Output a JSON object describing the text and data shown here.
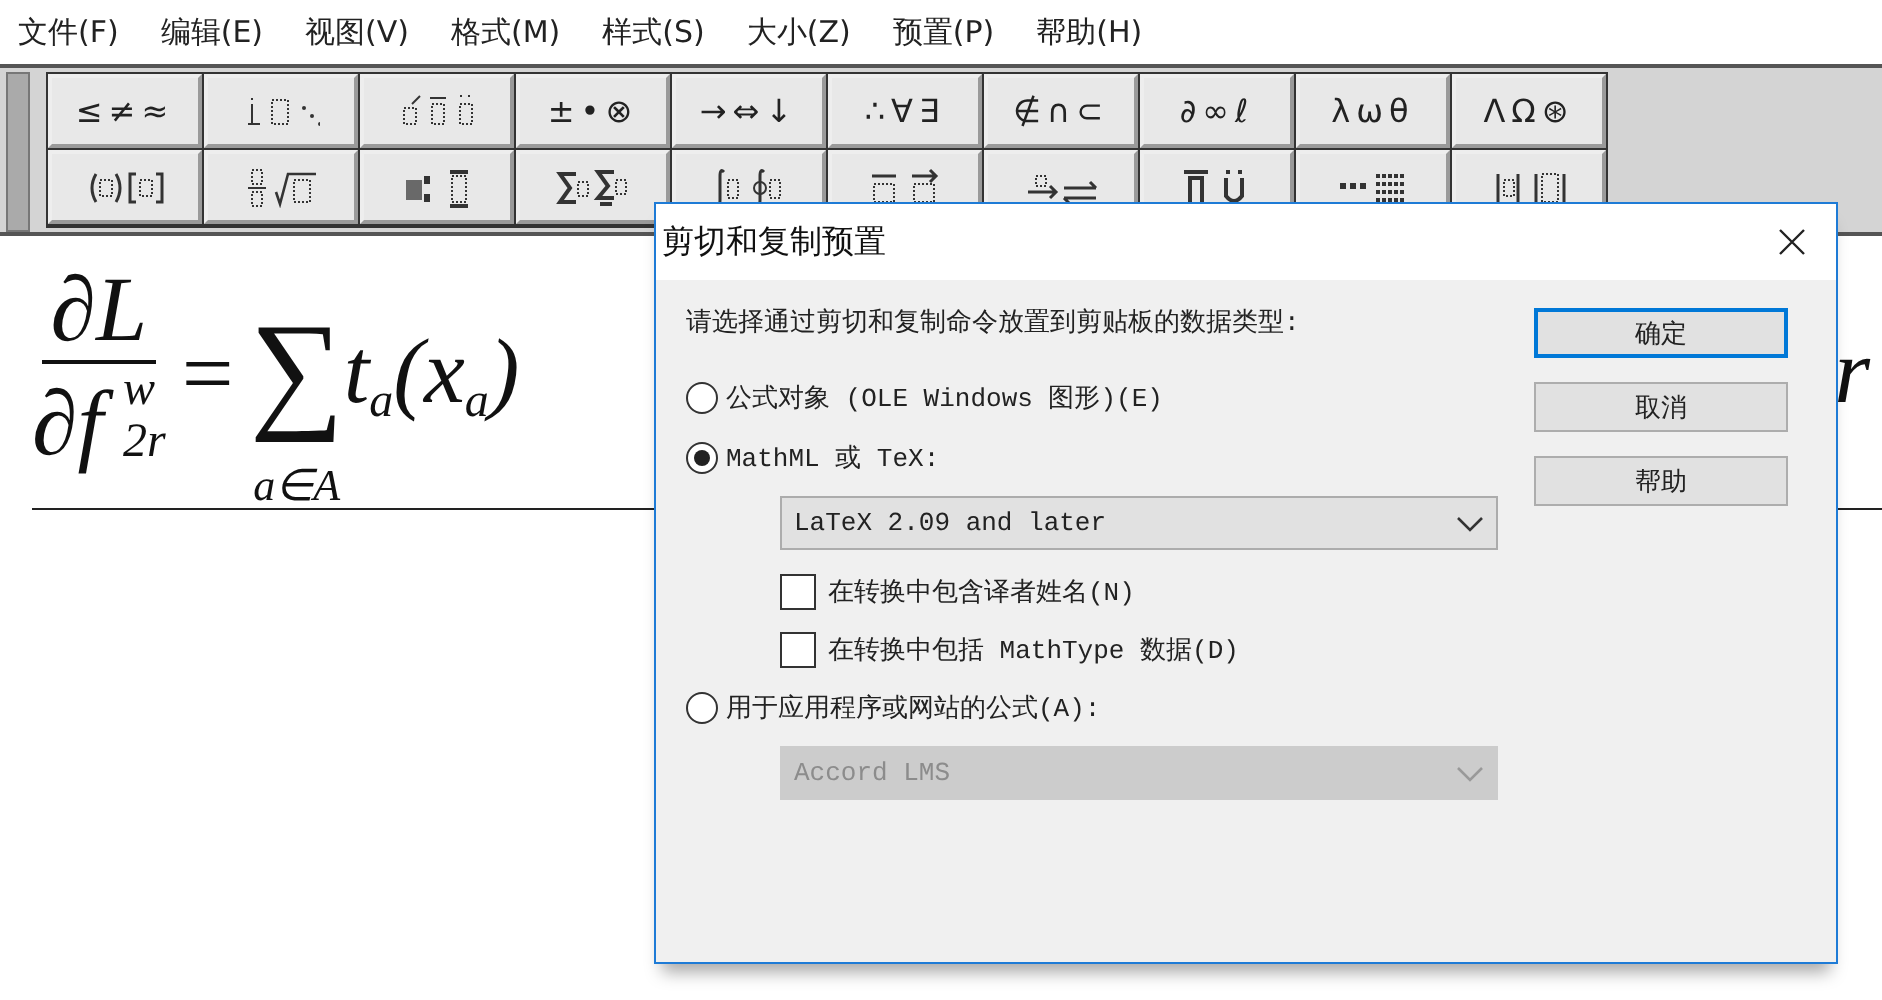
{
  "menu": [
    {
      "label": "文件(F)"
    },
    {
      "label": "编辑(E)"
    },
    {
      "label": "视图(V)"
    },
    {
      "label": "格式(M)"
    },
    {
      "label": "样式(S)"
    },
    {
      "label": "大小(Z)"
    },
    {
      "label": "预置(P)"
    },
    {
      "label": "帮助(H)"
    }
  ],
  "toolbar": {
    "rows": [
      [
        {
          "kind": "text",
          "label": "≤≠≈"
        },
        {
          "kind": "icon"
        },
        {
          "kind": "icon"
        },
        {
          "kind": "text",
          "label": "±•⊗"
        },
        {
          "kind": "text",
          "label": "→⇔↓"
        },
        {
          "kind": "text",
          "label": "∴∀∃"
        },
        {
          "kind": "text",
          "label": "∉∩⊂"
        },
        {
          "kind": "text",
          "label": "∂∞ℓ"
        },
        {
          "kind": "text",
          "label": "λωθ"
        },
        {
          "kind": "text",
          "label": "ΛΩ⊛"
        }
      ],
      [
        {
          "kind": "icon"
        },
        {
          "kind": "icon"
        },
        {
          "kind": "icon"
        },
        {
          "kind": "icon"
        },
        {
          "kind": "icon"
        },
        {
          "kind": "icon"
        },
        {
          "kind": "icon"
        },
        {
          "kind": "icon"
        },
        {
          "kind": "icon"
        },
        {
          "kind": "icon"
        }
      ]
    ]
  },
  "equation": {
    "numerator": "∂L",
    "denominator": "∂f",
    "denominator_sup": "w",
    "denominator_sub": "2r",
    "relation": "=",
    "operator": "∑",
    "operator_lower": "a∈A",
    "terms": [
      {
        "base": "t",
        "sub": "a"
      },
      {
        "base": "("
      },
      {
        "base": "x",
        "sub": "a"
      },
      {
        "base": ")"
      }
    ],
    "tail": "r"
  },
  "dialog": {
    "title": "剪切和复制预置",
    "prompt": "请选择通过剪切和复制命令放置到剪贴板的数据类型:",
    "options": [
      {
        "label": "公式对象 (OLE Windows 图形)(E)",
        "selected": false
      },
      {
        "label": "MathML 或 TeX:",
        "selected": true,
        "dropdown": {
          "value": "LaTeX 2.09 and later",
          "disabled": false
        },
        "checkboxes": [
          {
            "label": "在转换中包含译者姓名(N)",
            "checked": false
          },
          {
            "label": "在转换中包括 MathType 数据(D)",
            "checked": false
          }
        ]
      },
      {
        "label": "用于应用程序或网站的公式(A):",
        "selected": false,
        "dropdown": {
          "value": "Accord LMS",
          "disabled": true
        }
      }
    ],
    "buttons": [
      {
        "label": "确定",
        "focused": true
      },
      {
        "label": "取消",
        "focused": false
      },
      {
        "label": "帮助",
        "focused": false
      }
    ]
  }
}
